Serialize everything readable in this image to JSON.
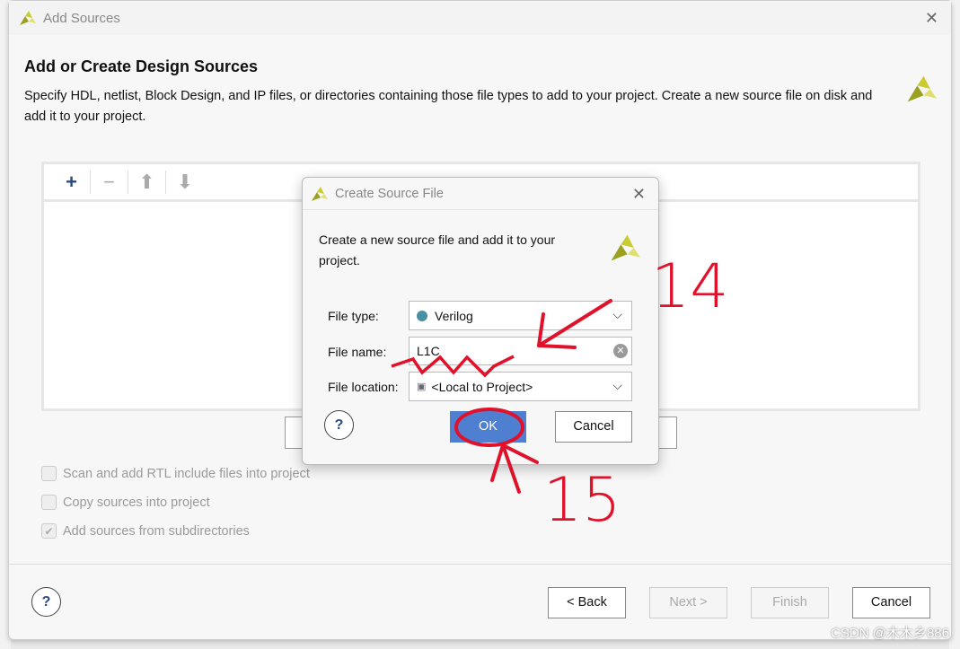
{
  "window": {
    "title": "Add Sources",
    "close": "✕"
  },
  "header": {
    "title": "Add or Create Design Sources",
    "description": "Specify HDL, netlist, Block Design, and IP files, or directories containing those file types to add to your project. Create a new source file on disk and add it to your project."
  },
  "toolbar": {
    "add": "+",
    "remove": "−",
    "up": "⬆",
    "down": "⬇"
  },
  "options": [
    {
      "label": "Scan and add RTL include files into project",
      "checked": false
    },
    {
      "label": "Copy sources into project",
      "checked": false
    },
    {
      "label": "Add sources from subdirectories",
      "checked": true
    }
  ],
  "footer": {
    "help": "?",
    "back": "< Back",
    "next": "Next >",
    "finish": "Finish",
    "cancel": "Cancel"
  },
  "modal": {
    "title": "Create Source File",
    "close": "✕",
    "description": "Create a new source file and add it to your project.",
    "file_type_label": "File type:",
    "file_type_value": "Verilog",
    "file_type_color": "#4a90a4",
    "file_name_label": "File name:",
    "file_name_value": "L1C",
    "file_location_label": "File location:",
    "file_location_value": "<Local to Project>",
    "help": "?",
    "ok": "OK",
    "cancel": "Cancel"
  },
  "annotations": {
    "step_a": "14",
    "step_b": "15",
    "color": "#e0112b"
  },
  "watermark": "CSDN @木木乡886"
}
